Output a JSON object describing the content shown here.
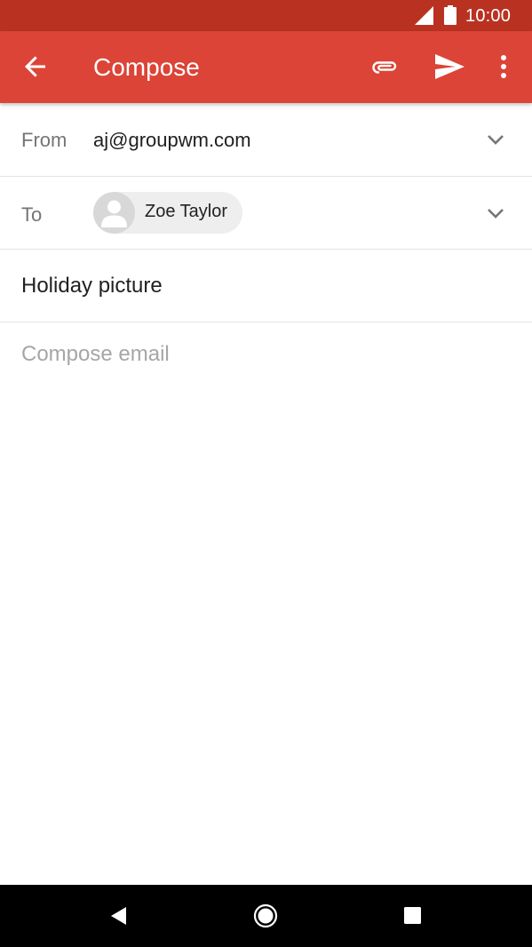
{
  "status_bar": {
    "time": "10:00",
    "icons": [
      "signal-icon",
      "battery-icon"
    ]
  },
  "app_bar": {
    "title": "Compose",
    "icons": [
      "back-arrow-icon",
      "paperclip-icon",
      "send-icon",
      "more-vert-icon"
    ]
  },
  "compose": {
    "from": {
      "label": "From",
      "value": "aj@groupwm.com",
      "icon": "chevron-down-icon"
    },
    "to": {
      "label": "To",
      "recipient": "Zoe Taylor",
      "avatar_icon": "person-icon",
      "icon": "chevron-down-icon"
    },
    "subject": {
      "value": "Holiday picture"
    },
    "body": {
      "placeholder": "Compose email",
      "value": ""
    }
  },
  "nav_bar": {
    "icons": [
      "nav-back-icon",
      "nav-home-icon",
      "nav-recents-icon"
    ]
  },
  "colors": {
    "status_bar": "#b93221",
    "app_bar": "#db4437",
    "chip_background": "#eeeeee",
    "divider": "#e3e3e3"
  }
}
